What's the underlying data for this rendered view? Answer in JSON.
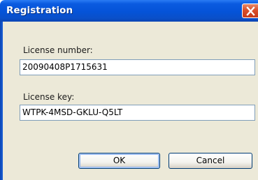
{
  "window": {
    "title": "Registration"
  },
  "fields": {
    "license_number_label": "License number:",
    "license_number_value": "20090408P1715631",
    "license_key_label": "License key:",
    "license_key_value": "WTPK-4MSD-GKLU-Q5LT"
  },
  "buttons": {
    "ok_label": "OK",
    "cancel_label": "Cancel"
  },
  "colors": {
    "titlebar": "#0553d8",
    "dialog_background": "#ece9d8",
    "close_button": "#d94f2a"
  },
  "icons": {
    "close": "close-icon"
  }
}
